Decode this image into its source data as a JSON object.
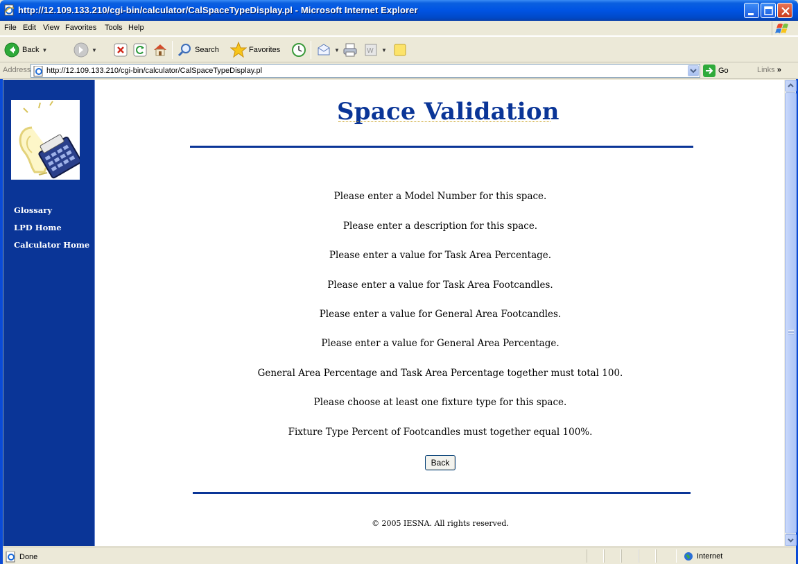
{
  "window": {
    "title": "http://12.109.133.210/cgi-bin/calculator/CalSpaceTypeDisplay.pl - Microsoft Internet Explorer"
  },
  "menu": [
    "File",
    "Edit",
    "View",
    "Favorites",
    "Tools",
    "Help"
  ],
  "toolbar": {
    "back_label": "Back",
    "search_label": "Search",
    "favorites_label": "Favorites"
  },
  "address": {
    "label": "Address",
    "url": "http://12.109.133.210/cgi-bin/calculator/CalSpaceTypeDisplay.pl",
    "go_label": "Go",
    "links_label": "Links"
  },
  "sidebar": {
    "links": [
      "Glossary",
      "LPD Home",
      "Calculator Home"
    ]
  },
  "page": {
    "title": "Space Validation",
    "messages": [
      "Please enter a Model Number for this space.",
      "Please enter a description for this space.",
      "Please enter a value for Task Area Percentage.",
      "Please enter a value for Task Area Footcandles.",
      "Please enter a value for General Area Footcandles.",
      "Please enter a value for General Area Percentage.",
      "General Area Percentage and Task Area Percentage together must total 100.",
      "Please choose at least one fixture type for this space.",
      "Fixture Type Percent of Footcandles must together equal 100%."
    ],
    "back_button": "Back",
    "footer": "© 2005 IESNA. All rights reserved."
  },
  "status": {
    "text": "Done",
    "zone": "Internet"
  },
  "colors": {
    "sidebar": "#0a3597",
    "heading": "#0a3597",
    "titlebar": "#0054e3"
  }
}
